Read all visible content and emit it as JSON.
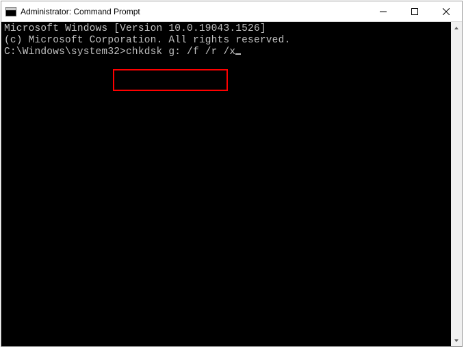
{
  "window": {
    "title": "Administrator: Command Prompt"
  },
  "terminal": {
    "line1": "Microsoft Windows [Version 10.0.19043.1526]",
    "line2": "(c) Microsoft Corporation. All rights reserved.",
    "blank": "",
    "prompt": "C:\\Windows\\system32>",
    "command": "chkdsk g: /f /r /x"
  }
}
